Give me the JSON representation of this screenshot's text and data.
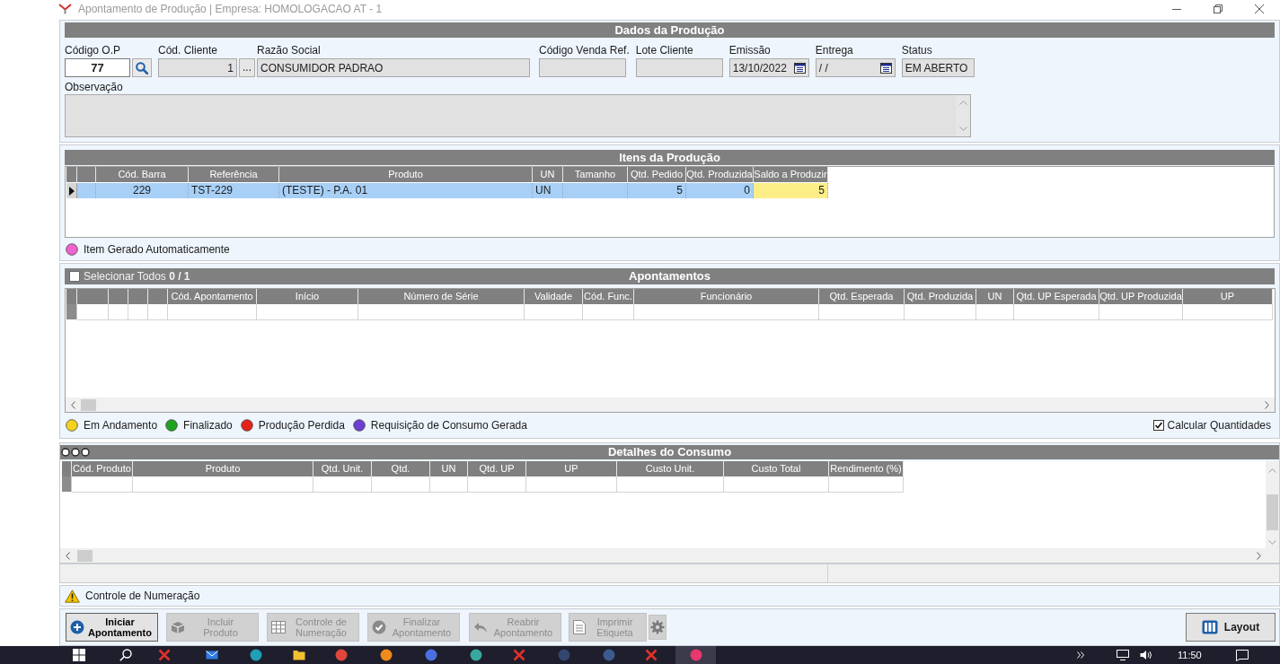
{
  "window": {
    "title": "Apontamento de Produção | Empresa: HOMOLOGACAO AT - 1"
  },
  "dados_producao": {
    "title": "Dados da Produção",
    "fields": [
      {
        "kind": "code",
        "label": "Código O.P",
        "value": "77"
      },
      {
        "kind": "lookup",
        "label": "Cód. Cliente",
        "value": "1",
        "button": "..."
      },
      {
        "kind": "text",
        "label": "Razão Social",
        "value": "CONSUMIDOR PADRAO"
      },
      {
        "kind": "text",
        "label": "Código Venda Ref."
      },
      {
        "kind": "text",
        "label": "Lote Cliente"
      },
      {
        "kind": "date",
        "label": "Emissão",
        "value": "13/10/2022"
      },
      {
        "kind": "date",
        "label": "Entrega",
        "value": "/ /"
      },
      {
        "kind": "text",
        "label": "Status",
        "value": "EM ABERTO"
      }
    ],
    "observacao": {
      "label": "Observação"
    }
  },
  "itens_producao": {
    "title": "Itens da Produção",
    "columns": [
      {
        "label": "Cód. Barra",
        "highlighted": false
      },
      {
        "label": "Referência",
        "highlighted": false
      },
      {
        "label": "Produto",
        "highlighted": false
      },
      {
        "label": "UN",
        "highlighted": false
      },
      {
        "label": "Tamanho",
        "highlighted": false
      },
      {
        "label": "Qtd. Pedido",
        "highlighted": false
      },
      {
        "label": "Qtd. Produzida",
        "highlighted": false
      },
      {
        "label": "Saldo a Produzir",
        "highlighted": true
      }
    ],
    "rows": [
      {
        "selected": true,
        "cod_barra": "229",
        "referencia": "TST-229",
        "produto": "(TESTE) - P.A. 01",
        "un": "UN",
        "qtd_pedido": "5",
        "qtd_produzida": "0",
        "saldo_a_produzir": "5"
      }
    ],
    "legend": [
      {
        "label": "Item Gerado Automaticamente",
        "color": "#f062d0"
      }
    ]
  },
  "apontamentos": {
    "title": "Apontamentos",
    "select_all": {
      "label": "Selecionar Todos **0 / 1**",
      "checked": false
    },
    "columns": [
      "Cód. Apontamento",
      "Início",
      "Número de Série",
      "Validade",
      "Cód. Func.",
      "Funcionário",
      "Qtd. Esperada",
      "Qtd. Produzida",
      "UN",
      "Qtd. UP Esperada",
      "Qtd. UP Produzida",
      "UP"
    ],
    "legend": [
      {
        "label": "Em Andamento",
        "color": "#f5d31a"
      },
      {
        "label": "Finalizado",
        "color": "#1fa31f"
      },
      {
        "label": "Produção Perdida",
        "color": "#e3231b"
      },
      {
        "label": "Requisição de Consumo Gerada",
        "color": "#6b3fd4"
      }
    ],
    "calcular_quantidades": {
      "label": "Calcular Quantidades",
      "checked": true
    }
  },
  "detalhes_consumo": {
    "title": "Detalhes do Consumo",
    "columns": [
      "Cód. Produto",
      "Produto",
      "Qtd. Unit.",
      "Qtd.",
      "UN",
      "Qtd. UP",
      "UP",
      "Custo Unit.",
      "Custo Total",
      "Rendimento (%)"
    ]
  },
  "controle_numeracao": {
    "label": "Controle de Numeração"
  },
  "toolbar": {
    "buttons": [
      {
        "label": "Iniciar Apontamento",
        "disabled": false
      },
      {
        "label": "Incluir Produto",
        "disabled": true
      },
      {
        "label": "Controle de Numeração",
        "disabled": true
      },
      {
        "label": "Finalizar Apontamento",
        "disabled": true
      },
      {
        "label": "Reabrir Apontamento",
        "disabled": true
      },
      {
        "label": "Imprimir Etiqueta",
        "disabled": true
      }
    ],
    "layout_button": {
      "label": "Layout"
    }
  },
  "taskbar": {
    "clock": "11:50"
  }
}
